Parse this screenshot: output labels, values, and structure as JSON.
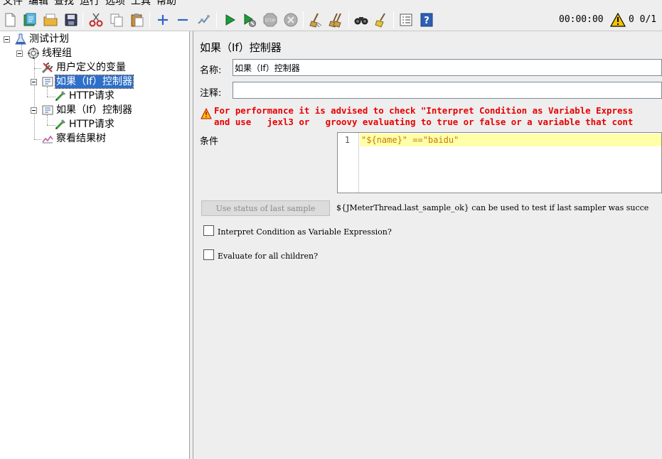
{
  "menu": [
    "文件",
    "编辑",
    "查找",
    "运行",
    "选项",
    "工具",
    "帮助"
  ],
  "toolbar": {
    "timer": "00:00:00",
    "warnings": "0",
    "threads": "0/1",
    "icons": [
      "new-icon",
      "templates-icon",
      "open-icon",
      "save-icon",
      "cut-icon",
      "copy-icon",
      "paste-icon",
      "expand-icon",
      "collapse-icon",
      "toggle-icon",
      "start-icon",
      "start-no-pause-icon",
      "stop-icon",
      "shutdown-icon",
      "clear-icon",
      "clear-all-icon",
      "search-icon",
      "reset-search-icon",
      "function-helper-icon",
      "help-icon"
    ]
  },
  "tree": {
    "nodes": [
      {
        "label": "测试计划",
        "icon": "test-plan-icon"
      },
      {
        "label": "线程组",
        "icon": "thread-group-icon"
      },
      {
        "label": "用户定义的变量",
        "icon": "config-element-icon"
      },
      {
        "label": "如果（If）控制器",
        "icon": "if-controller-icon",
        "selected": true
      },
      {
        "label": "HTTP请求",
        "icon": "http-sampler-icon"
      },
      {
        "label": "如果（If）控制器",
        "icon": "if-controller-icon"
      },
      {
        "label": "HTTP请求",
        "icon": "http-sampler-icon"
      },
      {
        "label": "察看结果树",
        "icon": "listener-icon"
      }
    ]
  },
  "panel": {
    "title": "如果（If）控制器",
    "name_label": "名称:",
    "name_value": "如果（If）控制器",
    "comment_label": "注释:",
    "comment_value": "",
    "warning_line1": "For performance it is advised to check \"Interpret Condition as Variable Express",
    "warning_line2": "and use   jexl3 or   groovy evaluating to true or false or a variable that cont",
    "condition_label": "条件",
    "line_number": "1",
    "condition_code": "\"${name}\" ==\"baidu\"",
    "use_last_sample_button": "Use status of last sample",
    "hint": "${JMeterThread.last_sample_ok} can be used to test if last sampler was succe",
    "interpret_checkbox": "Interpret Condition as Variable Expression?",
    "evaluate_checkbox": "Evaluate for all children?"
  },
  "colors": {
    "selection": "#2e6fc9",
    "warning_text": "#e60000",
    "code_text": "#c47d00",
    "current_line": "#ffffaa"
  }
}
